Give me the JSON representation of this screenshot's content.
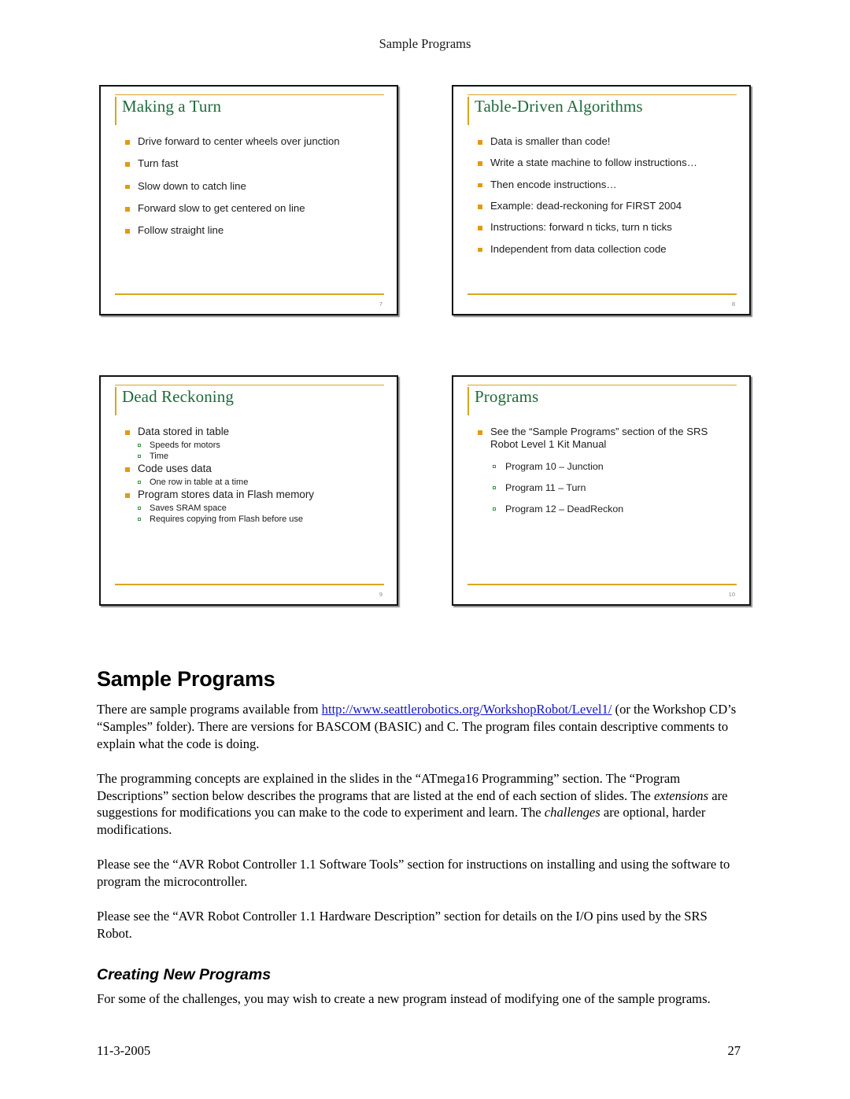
{
  "header": {
    "running_title": "Sample Programs"
  },
  "slides": [
    {
      "title": "Making a Turn",
      "number": "7",
      "bullets": [
        {
          "level": 1,
          "text": "Drive forward to center wheels over junction"
        },
        {
          "level": 1,
          "text": "Turn fast"
        },
        {
          "level": 1,
          "text": "Slow down to catch line"
        },
        {
          "level": 1,
          "text": "Forward slow to get centered on line"
        },
        {
          "level": 1,
          "text": "Follow straight line"
        }
      ]
    },
    {
      "title": "Table-Driven Algorithms",
      "number": "8",
      "bullets": [
        {
          "level": 1,
          "text": "Data is smaller than code!"
        },
        {
          "level": 1,
          "text": "Write a state machine to follow instructions…"
        },
        {
          "level": 1,
          "text": "Then encode instructions…"
        },
        {
          "level": 1,
          "text": "Example: dead-reckoning for FIRST 2004"
        },
        {
          "level": 1,
          "text": "Instructions: forward n ticks, turn n ticks"
        },
        {
          "level": 1,
          "text": "Independent from data collection code"
        }
      ]
    },
    {
      "title": "Dead Reckoning",
      "number": "9",
      "bullets": [
        {
          "level": 1,
          "text": "Data stored in table"
        },
        {
          "level": 2,
          "text": "Speeds for motors"
        },
        {
          "level": 2,
          "text": "Time"
        },
        {
          "level": 1,
          "text": "Code uses data"
        },
        {
          "level": 2,
          "text": "One row in table at a time"
        },
        {
          "level": 1,
          "text": "Program stores data in Flash memory"
        },
        {
          "level": 2,
          "text": "Saves SRAM space"
        },
        {
          "level": 2,
          "text": "Requires copying from Flash before use"
        }
      ]
    },
    {
      "title": "Programs",
      "number": "10",
      "bullets": [
        {
          "level": 1,
          "text": "See the “Sample Programs” section of the SRS Robot Level 1 Kit Manual"
        },
        {
          "level": 2,
          "text": "Program 10 – Junction"
        },
        {
          "level": 2,
          "text": "Program 11 – Turn"
        },
        {
          "level": 2,
          "text": "Program 12 – DeadReckon"
        }
      ]
    }
  ],
  "document": {
    "heading": "Sample Programs",
    "p1_before_link": "There are sample programs available from ",
    "link_text": "http://www.seattlerobotics.org/WorkshopRobot/Level1/",
    "p1_after_link": " (or the Workshop CD’s “Samples” folder). There are versions for BASCOM (BASIC) and C. The program files contain descriptive comments to explain what the code is doing.",
    "p2_a": "The programming concepts are explained in the slides in the “ATmega16 Programming” section. The “Program Descriptions” section below describes the programs that are listed at the end of each section of slides. The ",
    "p2_italic1": "extensions",
    "p2_b": " are suggestions for modifications you can make to the code to experiment and learn. The ",
    "p2_italic2": "challenges",
    "p2_c": " are optional, harder modifications.",
    "p3": "Please see the “AVR Robot Controller 1.1 Software Tools” section for instructions on installing and using the software to program the microcontroller.",
    "p4": "Please see the “AVR Robot Controller 1.1 Hardware Description” section for details on the I/O pins used by the SRS Robot.",
    "subheading": "Creating New Programs",
    "p5": "For some of the challenges, you may wish to create a new program instead of modifying one of the sample programs."
  },
  "footer": {
    "date": "11-3-2005",
    "page_number": "27"
  }
}
